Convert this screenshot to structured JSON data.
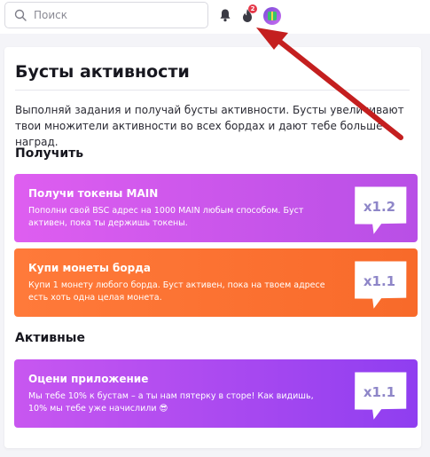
{
  "header": {
    "search_placeholder": "Поиск",
    "notifications_badge": "2"
  },
  "page": {
    "title": "Бусты активности",
    "description": "Выполняй задания и получай бусты активности. Бусты увеличивают твои множители активности во всех бордах и дают тебе больше наград."
  },
  "sections": {
    "get_label": "Получить",
    "active_label": "Активные"
  },
  "cards": [
    {
      "title": "Получи токены MAIN",
      "text": "Пополни свой BSC адрес на 1000 MAIN любым способом. Буст активен, пока ты держишь токены.",
      "multiplier": "x1.2"
    },
    {
      "title": "Купи монеты борда",
      "text": "Купи 1 монету любого борда. Буст активен, пока на твоем адресе есть хоть одна целая монета.",
      "multiplier": "x1.1"
    },
    {
      "title": "Оцени приложение",
      "text": "Мы тебе 10% к бустам – а ты нам пятерку в сторе! Как видишь, 10% мы тебе уже начислили 😎",
      "multiplier": "x1.1"
    }
  ],
  "colors": {
    "card1": "#de5ef0",
    "card2": "#ff7a3a",
    "card3": "#9b44f0",
    "arrow": "#c41f1f",
    "badge": "#e5394a"
  },
  "icons": [
    "search-icon",
    "bell-icon",
    "fire-icon",
    "avatar-gift-icon",
    "red-arrow-annotation"
  ]
}
